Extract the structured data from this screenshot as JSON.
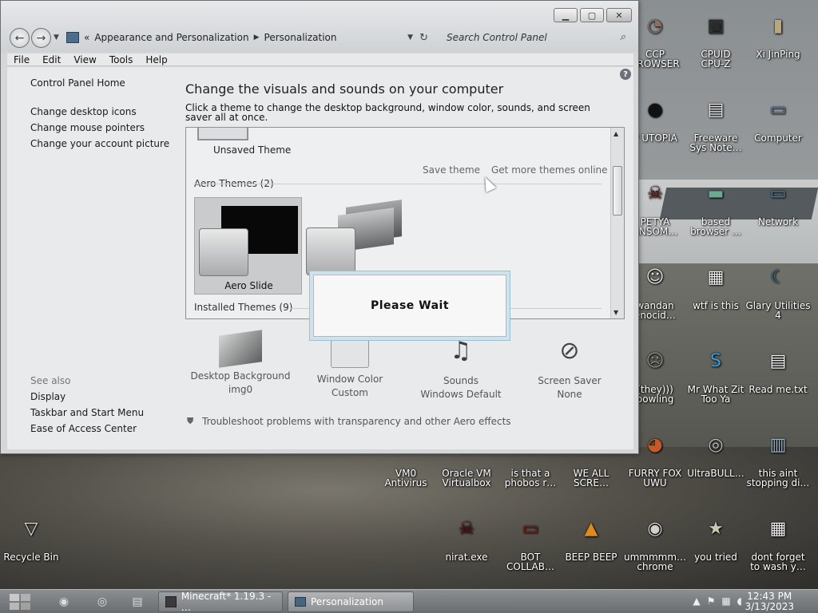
{
  "window": {
    "address": {
      "prefix": "«",
      "crumb1": "Appearance and Personalization",
      "crumb2": "Personalization"
    },
    "search_placeholder": "Search Control Panel",
    "menu": [
      "File",
      "Edit",
      "View",
      "Tools",
      "Help"
    ],
    "left_links": {
      "home": "Control Panel Home",
      "desktop_icons": "Change desktop icons",
      "mouse_pointers": "Change mouse pointers",
      "account_picture": "Change your account picture",
      "see_also": "See also",
      "display": "Display",
      "taskbar": "Taskbar and Start Menu",
      "ease": "Ease of Access Center"
    },
    "title": "Change the visuals and sounds on your computer",
    "subtitle": "Click a theme to change the desktop background, window color, sounds, and screen saver all at once.",
    "themes": {
      "unsaved": "Unsaved Theme",
      "save_theme": "Save theme",
      "get_more": "Get more themes online",
      "aero_header": "Aero Themes (2)",
      "aero_slide": "Aero Slide",
      "installed_header": "Installed Themes (9)"
    },
    "bottom": {
      "bg_label": "Desktop Background",
      "bg_value": "img0",
      "color_label": "Window Color",
      "color_value": "Custom",
      "sounds_label": "Sounds",
      "sounds_value": "Windows Default",
      "saver_label": "Screen Saver",
      "saver_value": "None"
    },
    "troubleshoot": "Troubleshoot problems with transparency and other Aero effects"
  },
  "dialog": {
    "text": "Please Wait"
  },
  "desktop_icons": [
    {
      "label": "CCP\nBROWSER",
      "icon": "browser-icon"
    },
    {
      "label": "CPUID\nCPU-Z",
      "icon": "cpuz-icon"
    },
    {
      "label": "Xi JinPing",
      "icon": "user-folder-icon"
    },
    {
      "label": "P UTOPIA",
      "icon": "dark-circle-icon"
    },
    {
      "label": "Freeware\nSys Note…",
      "icon": "document-icon"
    },
    {
      "label": "Computer",
      "icon": "computer-icon"
    },
    {
      "label": "PETYA\nANSOM…",
      "icon": "skull-icon"
    },
    {
      "label": "based\nbrowser …",
      "icon": "chat-icon"
    },
    {
      "label": "Network",
      "icon": "network-icon"
    },
    {
      "label": "wandan\nenocid…",
      "icon": "meme-icon"
    },
    {
      "label": "wtf is this",
      "icon": "calendar-file-icon"
    },
    {
      "label": "Glary Utilities\n4",
      "icon": "moon-icon"
    },
    {
      "label": "(they)))\nbowling",
      "icon": "meme-face-icon"
    },
    {
      "label": "Mr What Zit\nToo Ya",
      "icon": "skype-icon"
    },
    {
      "label": "Read me.txt",
      "icon": "text-file-icon"
    },
    {
      "label": "VM0\nAntivirus",
      "icon": "shield-icon"
    },
    {
      "label": "Oracle VM\nVirtualbox",
      "icon": "virtualbox-icon"
    },
    {
      "label": "is that a\nphobos r…",
      "icon": "file-icon"
    },
    {
      "label": "WE ALL\nSCRE…",
      "icon": "file-icon"
    },
    {
      "label": "FURRY FOX\nUWU",
      "icon": "firefox-icon"
    },
    {
      "label": "UltraBULL…",
      "icon": "disc-icon"
    },
    {
      "label": "this aint\nstopping di…",
      "icon": "installer-icon"
    },
    {
      "label": "Recycle Bin",
      "icon": "recycle-bin-icon"
    },
    {
      "label": "nirat.exe",
      "icon": "skull-icon"
    },
    {
      "label": "BOT\nCOLLAB…",
      "icon": "monitor-icon"
    },
    {
      "label": "BEEP BEEP",
      "icon": "vlc-cone-icon"
    },
    {
      "label": "ummmmm…\nchrome",
      "icon": "chrome-icon"
    },
    {
      "label": "you tried",
      "icon": "star-icon"
    },
    {
      "label": "dont forget\nto wash y…",
      "icon": "calendar-file-icon"
    }
  ],
  "taskbar": {
    "task1": "Minecraft* 1.19.3 - …",
    "task2": "Personalization",
    "time": "12:43 PM",
    "date": "3/13/2023"
  }
}
